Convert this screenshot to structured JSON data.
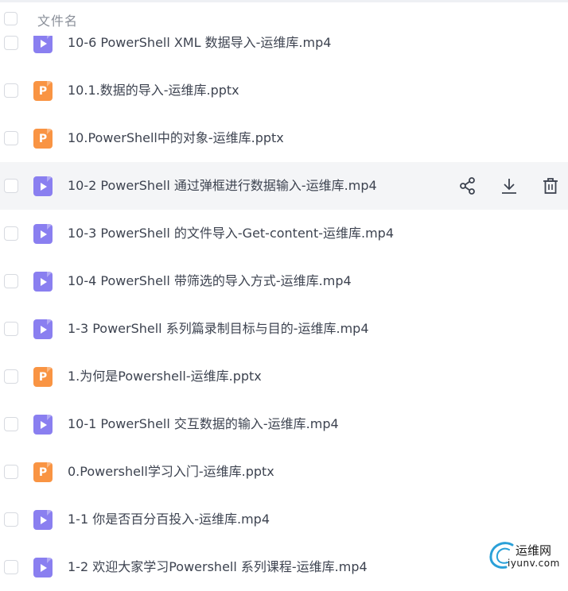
{
  "header": {
    "column_name": "文件名"
  },
  "files": [
    {
      "type": "video",
      "name": "10-6 PowerShell XML 数据导入-运维库.mp4"
    },
    {
      "type": "ppt",
      "icon_letter": "P",
      "name": "10.1.数据的导入-运维库.pptx"
    },
    {
      "type": "ppt",
      "icon_letter": "P",
      "name": "10.PowerShell中的对象-运维库.pptx"
    },
    {
      "type": "video",
      "name": "10-2 PowerShell 通过弹框进行数据输入-运维库.mp4"
    },
    {
      "type": "video",
      "name": "10-3 PowerShell 的文件导入-Get-content-运维库.mp4"
    },
    {
      "type": "video",
      "name": "10-4 PowerShell 带筛选的导入方式-运维库.mp4"
    },
    {
      "type": "video",
      "name": "1-3 PowerShell 系列篇录制目标与目的-运维库.mp4"
    },
    {
      "type": "ppt",
      "icon_letter": "P",
      "name": "1.为何是Powershell-运维库.pptx"
    },
    {
      "type": "video",
      "name": "10-1 PowerShell 交互数据的输入-运维库.mp4"
    },
    {
      "type": "ppt",
      "icon_letter": "P",
      "name": "0.Powershell学习入门-运维库.pptx"
    },
    {
      "type": "video",
      "name": "1-1 你是否百分百投入-运维库.mp4"
    },
    {
      "type": "video",
      "name": "1-2 欢迎大家学习Powershell 系列课程-运维库.mp4"
    }
  ],
  "hover_row_index": 3,
  "row_actions": [
    "share-icon",
    "download-icon",
    "delete-icon"
  ],
  "watermark": {
    "line1": "运维网",
    "line2": "iyunv.com"
  },
  "colors": {
    "video_icon": "#8a7ff0",
    "ppt_icon": "#f99443",
    "hover_bg": "#f4f5f7",
    "text": "#3d4350"
  }
}
